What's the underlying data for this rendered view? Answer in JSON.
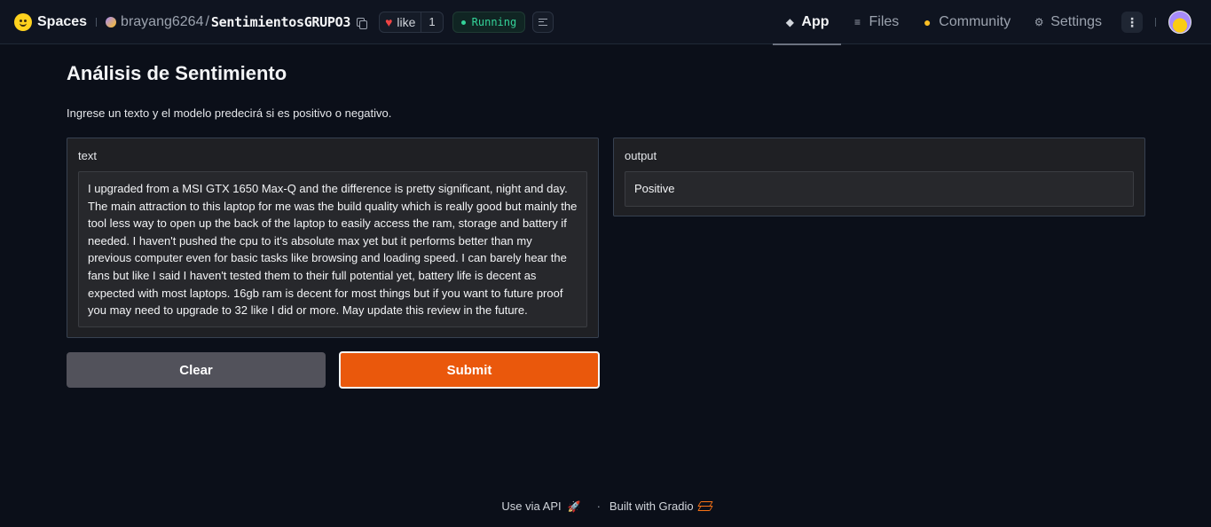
{
  "header": {
    "spaces_label": "Spaces",
    "owner": "brayang6264",
    "separator": "/",
    "repo": "SentimientosGRUPO3",
    "like_label": "like",
    "like_count": "1",
    "status": "Running",
    "status_color": "#34d399",
    "tabs": [
      {
        "label": "App",
        "icon": "cube-icon"
      },
      {
        "label": "Files",
        "icon": "files-icon"
      },
      {
        "label": "Community",
        "icon": "community-icon"
      },
      {
        "label": "Settings",
        "icon": "gear-icon"
      }
    ],
    "more_label": "⋮"
  },
  "main": {
    "title": "Análisis de Sentimiento",
    "description": "Ingrese un texto y el modelo predecirá si es positivo o negativo.",
    "input_label": "text",
    "input_value": "I upgraded from a MSI GTX 1650 Max-Q and the difference is pretty significant, night and day. The main attraction to this laptop for me was the build quality which is really good but mainly the tool less way to open up the back of the laptop to easily access the ram, storage and battery if needed. I haven't pushed the cpu to it's absolute max yet but it performs better than my previous computer even for basic tasks like browsing and loading speed. I can barely hear the fans but like I said I haven't tested them to their full potential yet, battery life is decent as expected with most laptops. 16gb ram is decent for most things but if you want to future proof you may need to upgrade to 32 like I did or more. May update this review in the future.",
    "output_label": "output",
    "output_value": "Positive",
    "clear_label": "Clear",
    "submit_label": "Submit",
    "submit_color": "#ea580c"
  },
  "footer": {
    "api_label": "Use via API",
    "dot": "·",
    "built_label": "Built with Gradio"
  }
}
